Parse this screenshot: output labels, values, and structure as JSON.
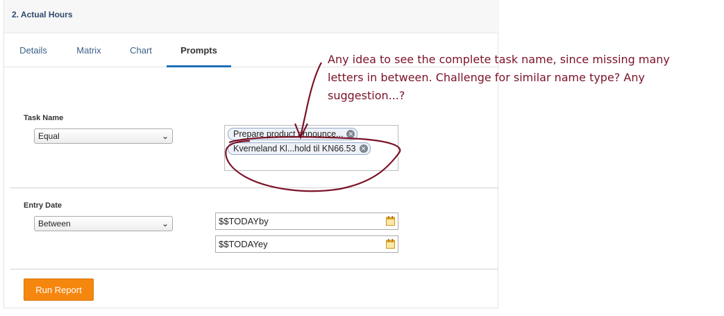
{
  "panel": {
    "title": "2. Actual Hours"
  },
  "tabs": [
    {
      "label": "Details",
      "active": false
    },
    {
      "label": "Matrix",
      "active": false
    },
    {
      "label": "Chart",
      "active": false
    },
    {
      "label": "Prompts",
      "active": true
    }
  ],
  "task_name": {
    "label": "Task Name",
    "operator": "Equal",
    "selected": [
      "Prepare product announce...",
      "Kverneland Kl...hold til KN66.53"
    ]
  },
  "entry_date": {
    "label": "Entry Date",
    "operator": "Between",
    "from": "$$TODAYby",
    "to": "$$TODAYey"
  },
  "run_button": {
    "label": "Run Report"
  },
  "annotation": {
    "text": "Any idea to see the complete task name, since missing many letters in between. Challenge for similar name type? Any suggestion...?",
    "color": "#7a1227"
  },
  "colors": {
    "accent_tab": "#1d6fb8",
    "run_button": "#f5870f",
    "tab_text": "#3a5f86"
  }
}
